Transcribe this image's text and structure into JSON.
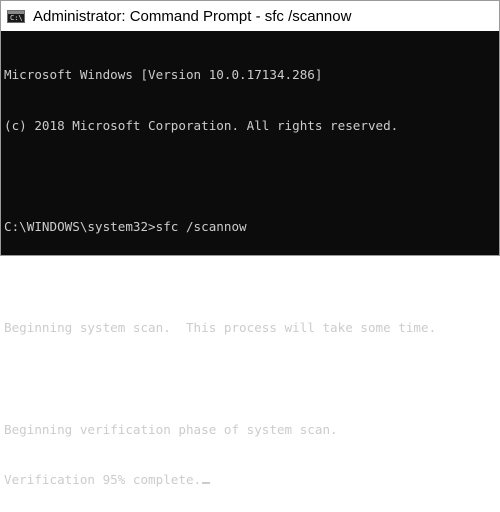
{
  "window": {
    "title": "Administrator: Command Prompt - sfc  /scannow",
    "icon": "command-prompt-icon",
    "icon_glyph": "C:\\",
    "background": "#0c0c0c",
    "text_color": "#cccccc"
  },
  "console": {
    "lines": [
      "Microsoft Windows [Version 10.0.17134.286]",
      "(c) 2018 Microsoft Corporation. All rights reserved.",
      "",
      "C:\\WINDOWS\\system32>sfc /scannow",
      "",
      "Beginning system scan.  This process will take some time.",
      "",
      "Beginning verification phase of system scan.",
      "Verification 95% complete."
    ]
  }
}
